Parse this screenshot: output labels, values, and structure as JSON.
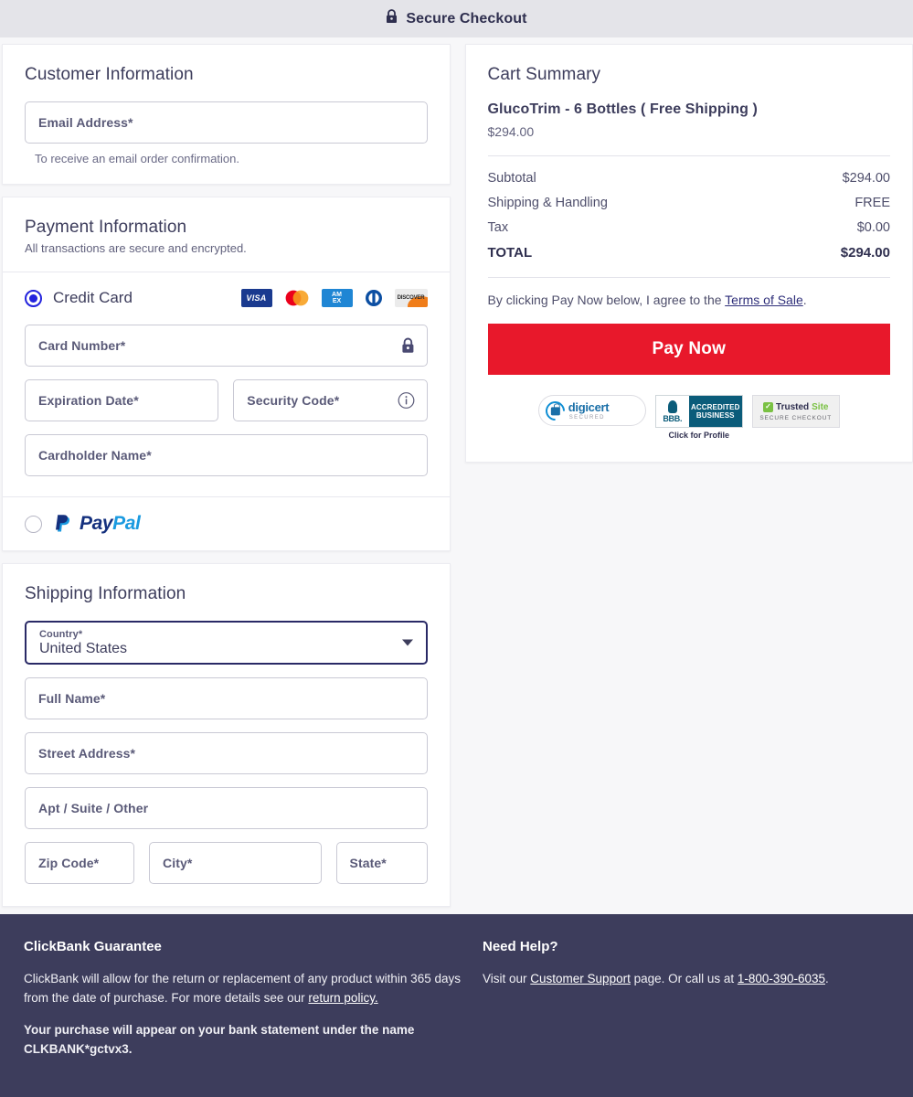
{
  "header": {
    "title": "Secure Checkout",
    "lock_icon": "lock-icon"
  },
  "customer": {
    "section_title": "Customer Information",
    "email_label": "Email Address*",
    "email_value": "",
    "email_hint": "To receive an email order confirmation."
  },
  "payment": {
    "section_title": "Payment Information",
    "section_sub": "All transactions are secure and encrypted.",
    "credit_card_label": "Credit Card",
    "credit_card_selected": true,
    "card_brands": [
      "VISA",
      "Mastercard",
      "AMEX",
      "Diners Club",
      "Discover"
    ],
    "brand_visa_text": "VISA",
    "brand_amex_line1": "AM",
    "brand_amex_line2": "EX",
    "brand_discover_text": "DISCOVER",
    "card_number_label": "Card Number*",
    "card_number_value": "",
    "expiration_label": "Expiration Date*",
    "expiration_value": "",
    "security_label": "Security Code*",
    "security_value": "",
    "cardholder_label": "Cardholder Name*",
    "cardholder_value": "",
    "paypal_label_pay": "Pay",
    "paypal_label_pal": "Pal",
    "paypal_selected": false
  },
  "shipping": {
    "section_title": "Shipping Information",
    "country_label": "Country*",
    "country_value": "United States",
    "full_name_label": "Full Name*",
    "full_name_value": "",
    "street_label": "Street Address*",
    "street_value": "",
    "apt_label": "Apt / Suite / Other",
    "apt_value": "",
    "zip_label": "Zip Code*",
    "zip_value": "",
    "city_label": "City*",
    "city_value": "",
    "state_label": "State*",
    "state_value": ""
  },
  "cart": {
    "section_title": "Cart Summary",
    "product_name": "GlucoTrim - 6 Bottles ( Free Shipping )",
    "product_price": "$294.00",
    "rows": [
      {
        "label": "Subtotal",
        "value": "$294.00"
      },
      {
        "label": "Shipping & Handling",
        "value": "FREE"
      },
      {
        "label": "Tax",
        "value": "$0.00"
      }
    ],
    "total_label": "TOTAL",
    "total_value": "$294.00",
    "terms_prefix": "By clicking Pay Now below, I agree to the ",
    "terms_link": "Terms of Sale",
    "terms_suffix": ".",
    "pay_now_label": "Pay Now",
    "pay_now_color": "#e8182b"
  },
  "badges": {
    "digicert_main": "digicert",
    "digicert_sub": "SECURED",
    "bbb_abbr": "BBB.",
    "bbb_line1": "ACCREDITED",
    "bbb_line2": "BUSINESS",
    "bbb_cta": "Click for Profile",
    "trustedsite_trusted": "Trusted",
    "trustedsite_site": "Site",
    "trustedsite_sub": "SECURE CHECKOUT"
  },
  "footer": {
    "guarantee_title": "ClickBank Guarantee",
    "guarantee_text_1": "ClickBank will allow for the return or replacement of any product within 365 days from the date of purchase. For more details see our ",
    "guarantee_link": "return policy.",
    "guarantee_text_2": "Your purchase will appear on your bank statement under the name CLKBANK*gctvx3.",
    "help_title": "Need Help?",
    "help_prefix": "Visit our ",
    "help_link_support": "Customer Support",
    "help_middle": " page. Or call us at ",
    "help_link_phone": "1-800-390-6035",
    "help_suffix": "."
  }
}
